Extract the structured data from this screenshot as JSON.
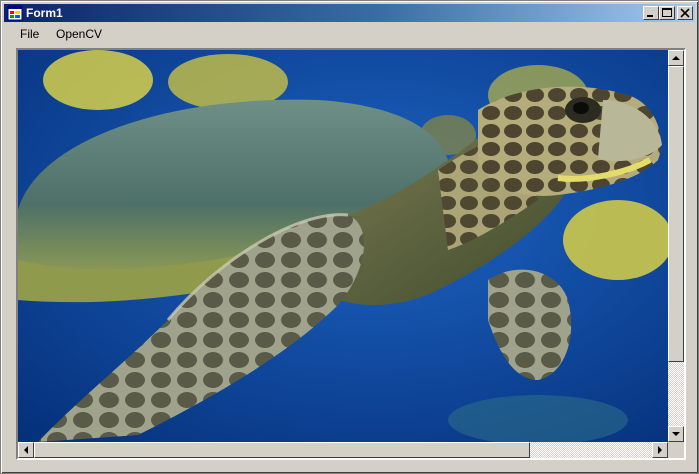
{
  "window": {
    "title": "Form1",
    "icon": "app-form-icon",
    "controls": [
      "minimize-icon",
      "maximize-icon",
      "close-icon"
    ]
  },
  "menu": {
    "items": [
      {
        "label": "File"
      },
      {
        "label": "OpenCV"
      }
    ]
  },
  "image": {
    "subject": "sea turtle swimming among yellow reef fish",
    "background_color": "#0a3f8f"
  },
  "scrollbars": {
    "vertical": {
      "thumb_fraction": 0.78
    },
    "horizontal": {
      "thumb_fraction": 0.78
    }
  },
  "colors": {
    "titlebar_start": "#0a246a",
    "titlebar_end": "#a6caf0",
    "face": "#d4d0c8"
  }
}
